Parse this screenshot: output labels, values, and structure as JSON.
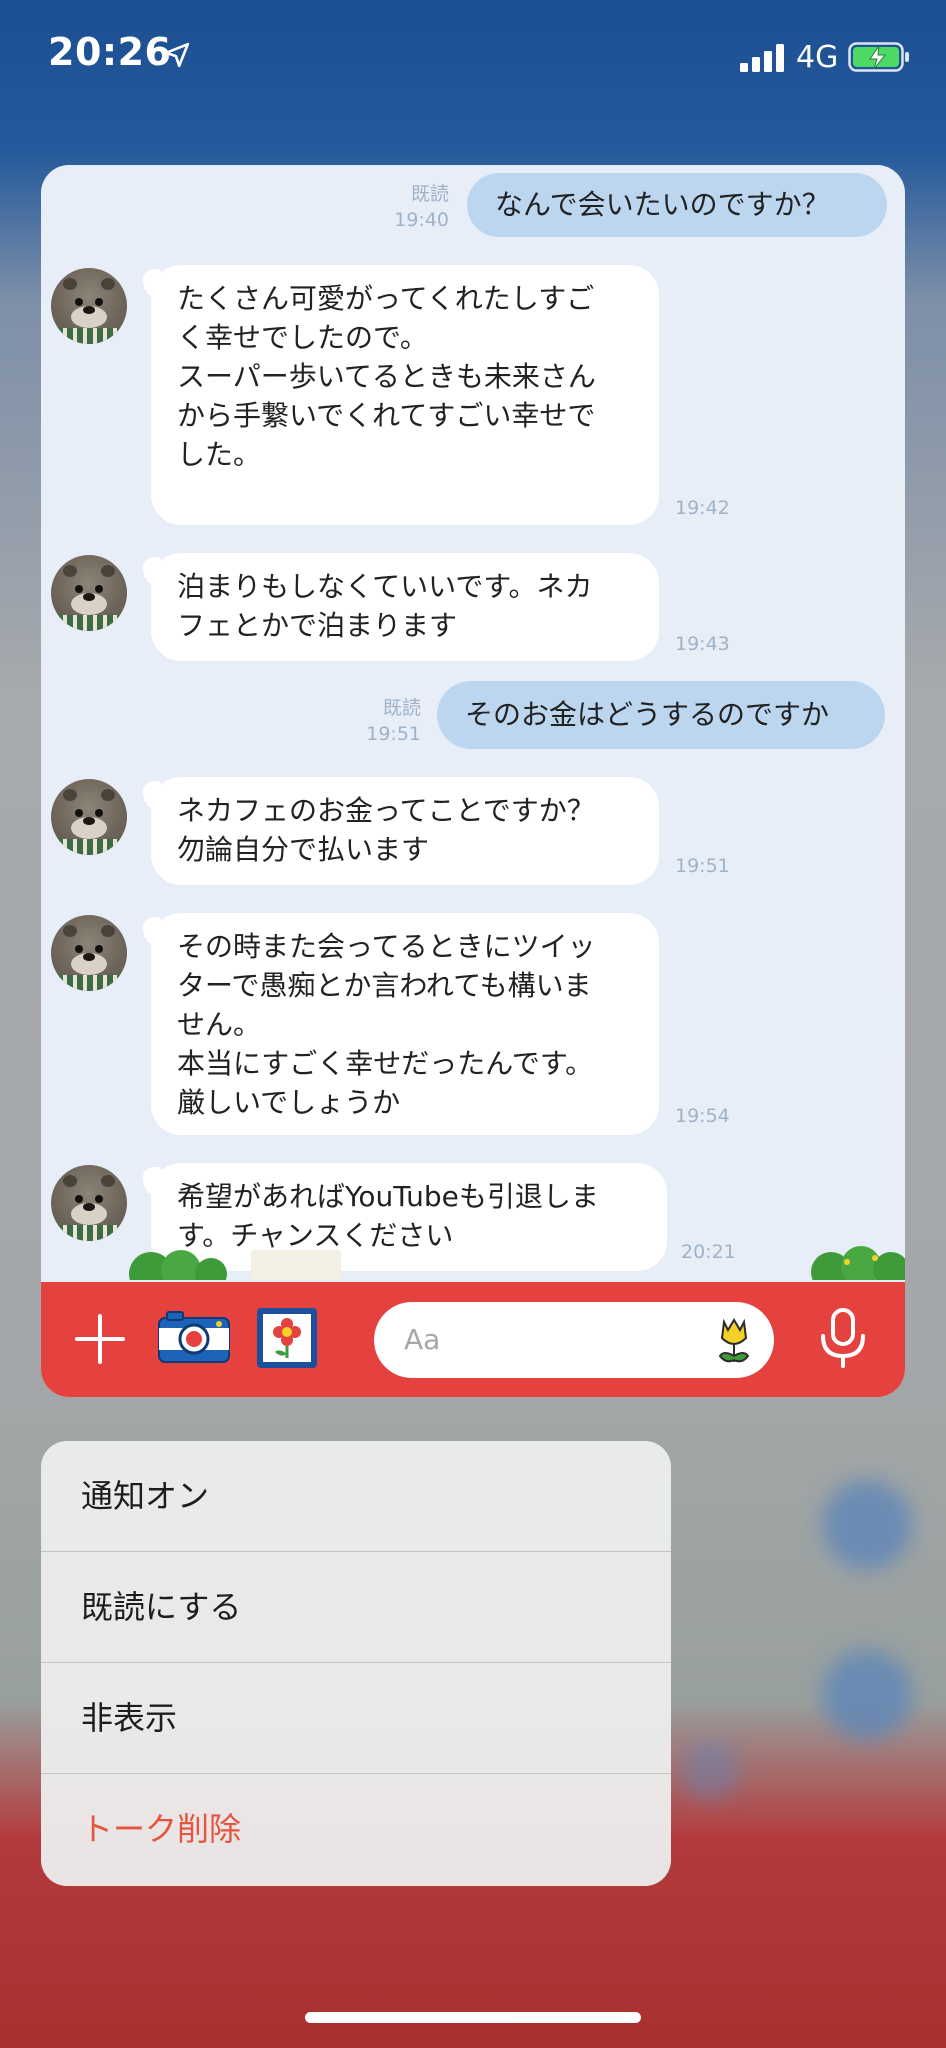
{
  "status_bar": {
    "time": "20:26",
    "network": "4G",
    "icons": [
      "location-arrow-icon",
      "signal-bars-icon",
      "battery-charging-icon"
    ]
  },
  "chat": {
    "messages": [
      {
        "from": "me",
        "read": "既読",
        "time": "19:40",
        "text": "なんで会いたいのですか？"
      },
      {
        "from": "other",
        "time": "19:42",
        "text": "たくさん可愛がってくれたしすご\nく幸せでしたので。\nスーパー歩いてるときも未来さん\nから手繋いでくれてすごい幸せで\nした。"
      },
      {
        "from": "other",
        "time": "19:43",
        "text": "泊まりもしなくていいです。ネカ\nフェとかで泊まります"
      },
      {
        "from": "me",
        "read": "既読",
        "time": "19:51",
        "text": "そのお金はどうするのですか"
      },
      {
        "from": "other",
        "time": "19:51",
        "text": "ネカフェのお金ってことですか？\n勿論自分で払います"
      },
      {
        "from": "other",
        "time": "19:54",
        "text": "その時また会ってるときにツイッ\nターで愚痴とか言われても構いま\nせん。\n本当にすごく幸せだったんです。\n厳しいでしょうか"
      },
      {
        "from": "other",
        "time": "20:21",
        "text": "希望があればYouTubeも引退しま\nす。チャンスください"
      }
    ]
  },
  "input_bar": {
    "placeholder": "Aa",
    "accent_color": "#e5413e",
    "icons": [
      "plus-icon",
      "camera-icon",
      "sticker-icon",
      "emoji-icon",
      "microphone-icon"
    ]
  },
  "context_menu": {
    "items": [
      {
        "label": "通知オン",
        "style": "normal"
      },
      {
        "label": "既読にする",
        "style": "normal"
      },
      {
        "label": "非表示",
        "style": "normal"
      },
      {
        "label": "トーク削除",
        "style": "destructive",
        "color": "#e5543f"
      }
    ]
  }
}
